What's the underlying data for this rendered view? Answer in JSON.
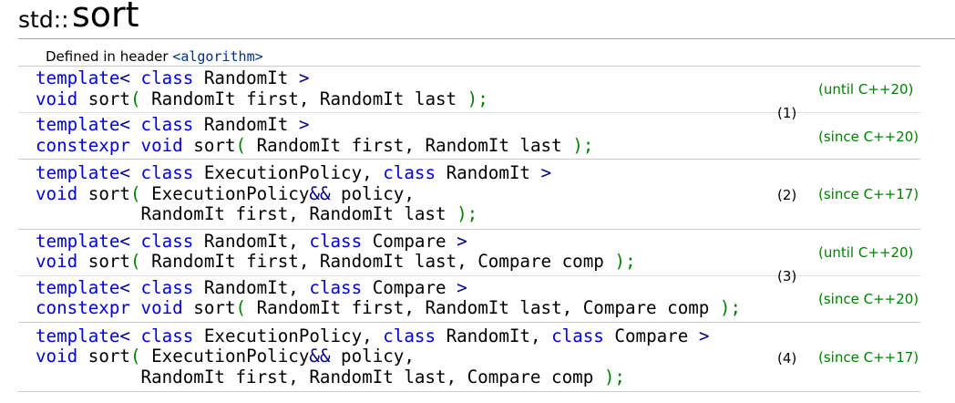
{
  "page": {
    "namespace": "std::",
    "name": "sort",
    "header_label": "Defined in header ",
    "header_link": "<algorithm>"
  },
  "overloads": [
    {
      "number": "(1)",
      "variants": [
        {
          "version": "(until C++20)",
          "lines": [
            [
              [
                "kw",
                "template"
              ],
              [
                "sy",
                "<"
              ],
              [
                "t",
                " "
              ],
              [
                "kw",
                "class"
              ],
              [
                "t",
                " RandomIt "
              ],
              [
                "sy",
                ">"
              ]
            ],
            [
              [
                "kw",
                "void"
              ],
              [
                "t",
                " sort"
              ],
              [
                "pn",
                "("
              ],
              [
                "t",
                " RandomIt first, RandomIt last "
              ],
              [
                "pn",
                ");"
              ]
            ]
          ]
        },
        {
          "version": "(since C++20)",
          "lines": [
            [
              [
                "kw",
                "template"
              ],
              [
                "sy",
                "<"
              ],
              [
                "t",
                " "
              ],
              [
                "kw",
                "class"
              ],
              [
                "t",
                " RandomIt "
              ],
              [
                "sy",
                ">"
              ]
            ],
            [
              [
                "kw",
                "constexpr"
              ],
              [
                "t",
                " "
              ],
              [
                "kw",
                "void"
              ],
              [
                "t",
                " sort"
              ],
              [
                "pn",
                "("
              ],
              [
                "t",
                " RandomIt first, RandomIt last "
              ],
              [
                "pn",
                ");"
              ]
            ]
          ]
        }
      ]
    },
    {
      "number": "(2)",
      "variants": [
        {
          "version": "(since C++17)",
          "lines": [
            [
              [
                "kw",
                "template"
              ],
              [
                "sy",
                "<"
              ],
              [
                "t",
                " "
              ],
              [
                "kw",
                "class"
              ],
              [
                "t",
                " ExecutionPolicy, "
              ],
              [
                "kw",
                "class"
              ],
              [
                "t",
                " RandomIt "
              ],
              [
                "sy",
                ">"
              ]
            ],
            [
              [
                "kw",
                "void"
              ],
              [
                "t",
                " sort"
              ],
              [
                "pn",
                "("
              ],
              [
                "t",
                " ExecutionPolicy"
              ],
              [
                "sy",
                "&&"
              ],
              [
                "t",
                " policy,"
              ]
            ],
            [
              [
                "t",
                "          RandomIt first, RandomIt last "
              ],
              [
                "pn",
                ");"
              ]
            ]
          ]
        }
      ]
    },
    {
      "number": "(3)",
      "variants": [
        {
          "version": "(until C++20)",
          "lines": [
            [
              [
                "kw",
                "template"
              ],
              [
                "sy",
                "<"
              ],
              [
                "t",
                " "
              ],
              [
                "kw",
                "class"
              ],
              [
                "t",
                " RandomIt, "
              ],
              [
                "kw",
                "class"
              ],
              [
                "t",
                " Compare "
              ],
              [
                "sy",
                ">"
              ]
            ],
            [
              [
                "kw",
                "void"
              ],
              [
                "t",
                " sort"
              ],
              [
                "pn",
                "("
              ],
              [
                "t",
                " RandomIt first, RandomIt last, Compare comp "
              ],
              [
                "pn",
                ");"
              ]
            ]
          ]
        },
        {
          "version": "(since C++20)",
          "lines": [
            [
              [
                "kw",
                "template"
              ],
              [
                "sy",
                "<"
              ],
              [
                "t",
                " "
              ],
              [
                "kw",
                "class"
              ],
              [
                "t",
                " RandomIt, "
              ],
              [
                "kw",
                "class"
              ],
              [
                "t",
                " Compare "
              ],
              [
                "sy",
                ">"
              ]
            ],
            [
              [
                "kw",
                "constexpr"
              ],
              [
                "t",
                " "
              ],
              [
                "kw",
                "void"
              ],
              [
                "t",
                " sort"
              ],
              [
                "pn",
                "("
              ],
              [
                "t",
                " RandomIt first, RandomIt last, Compare comp "
              ],
              [
                "pn",
                ");"
              ]
            ]
          ]
        }
      ]
    },
    {
      "number": "(4)",
      "variants": [
        {
          "version": "(since C++17)",
          "lines": [
            [
              [
                "kw",
                "template"
              ],
              [
                "sy",
                "<"
              ],
              [
                "t",
                " "
              ],
              [
                "kw",
                "class"
              ],
              [
                "t",
                " ExecutionPolicy, "
              ],
              [
                "kw",
                "class"
              ],
              [
                "t",
                " RandomIt, "
              ],
              [
                "kw",
                "class"
              ],
              [
                "t",
                " Compare "
              ],
              [
                "sy",
                ">"
              ]
            ],
            [
              [
                "kw",
                "void"
              ],
              [
                "t",
                " sort"
              ],
              [
                "pn",
                "("
              ],
              [
                "t",
                " ExecutionPolicy"
              ],
              [
                "sy",
                "&&"
              ],
              [
                "t",
                " policy,"
              ]
            ],
            [
              [
                "t",
                "          RandomIt first, RandomIt last, Compare comp "
              ],
              [
                "pn",
                ");"
              ]
            ]
          ]
        }
      ]
    }
  ],
  "colors": {
    "keyword": "#0000dd",
    "symbol": "#000080",
    "paren": "#008000",
    "version": "#008000",
    "link": "#003080"
  }
}
